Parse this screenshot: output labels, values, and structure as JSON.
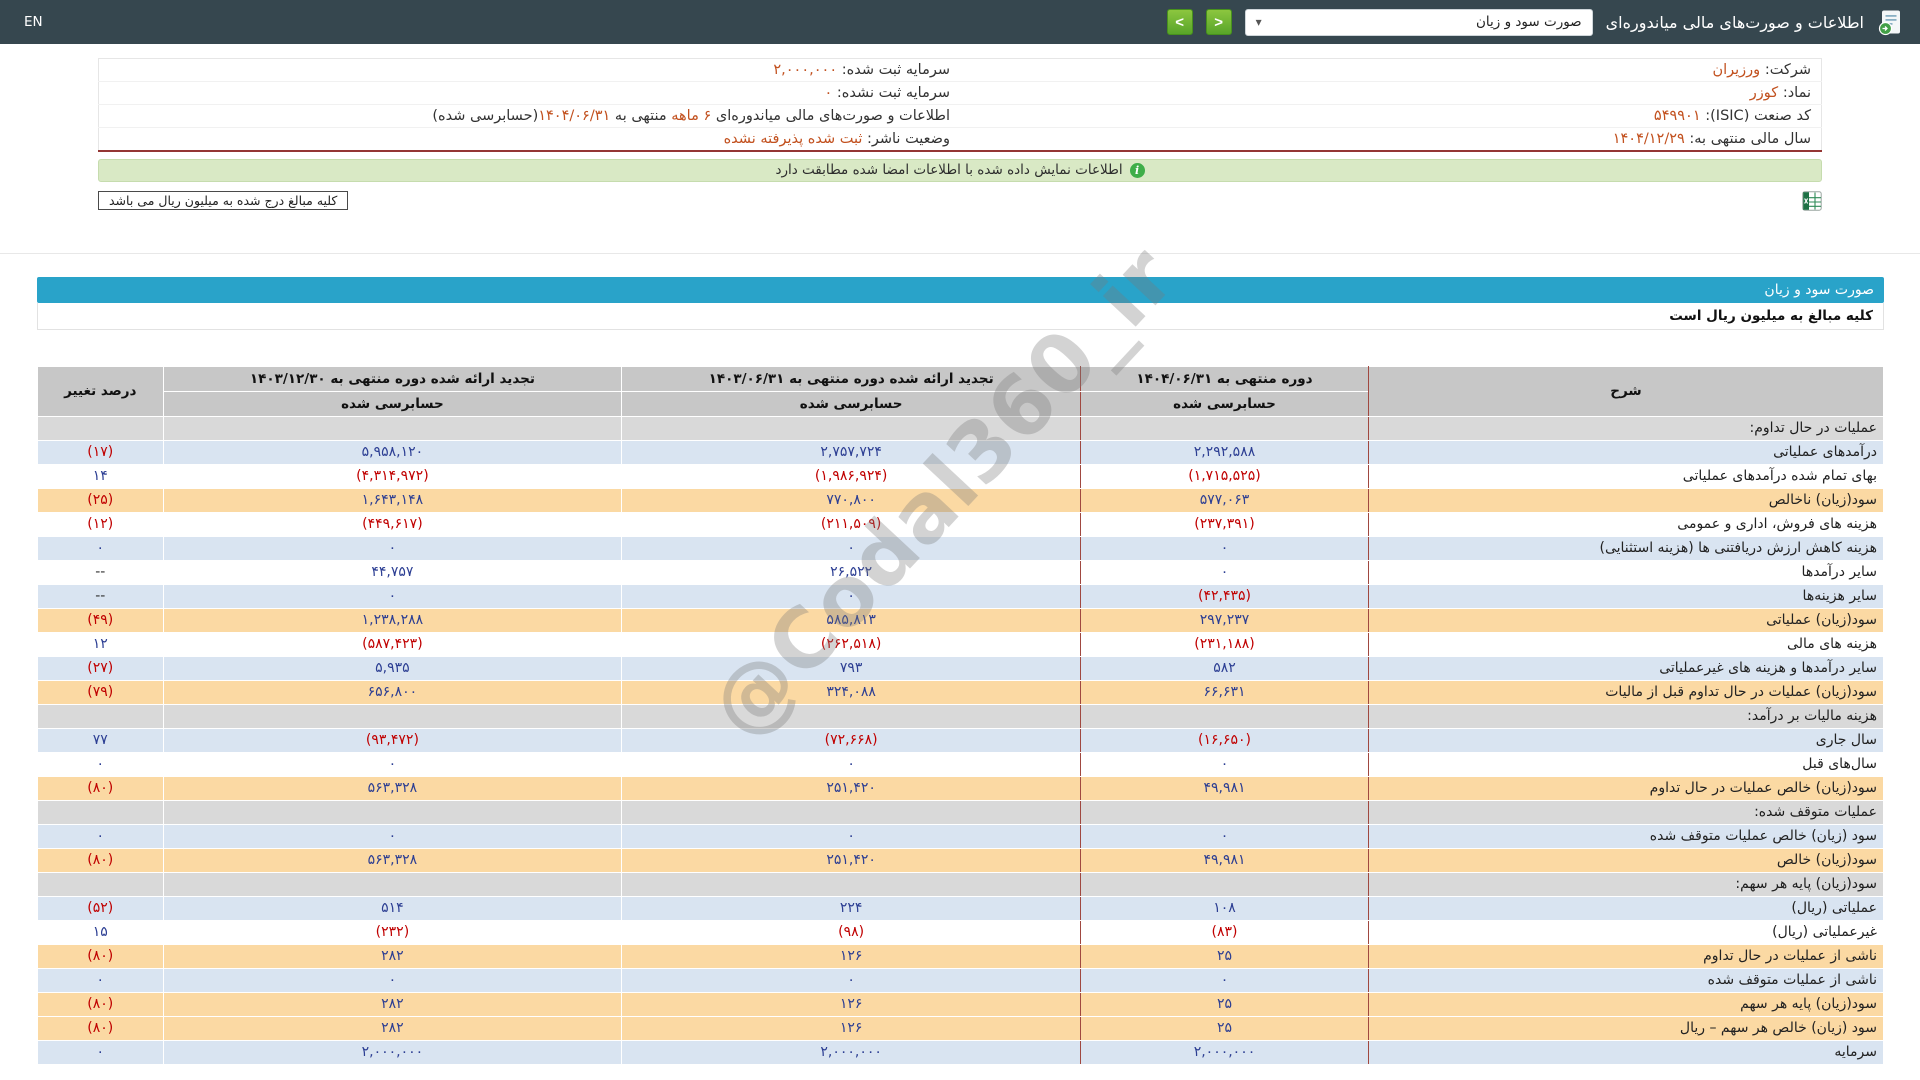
{
  "topbar": {
    "title": "اطلاعات و صورت‌های مالی میاندوره‌ای",
    "select_value": "صورت سود و زیان",
    "select_caret": "▾",
    "prev_glyph": "<",
    "next_glyph": ">",
    "lang": "EN"
  },
  "company": {
    "company_label": "شرکت:",
    "company_value": "ورزیران",
    "symbol_label": "نماد:",
    "symbol_value": "کوزر",
    "isic_label": "کد صنعت (ISIC):",
    "isic_value": "۵۴۹۹۰۱",
    "fiscal_year_label": "سال مالی منتهی به:",
    "fiscal_year_value": "۱۴۰۴/۱۲/۲۹",
    "capital_registered_label": "سرمایه ثبت شده:",
    "capital_registered_value": "۲,۰۰۰,۰۰۰",
    "capital_unregistered_label": "سرمایه ثبت نشده:",
    "capital_unregistered_value": "۰",
    "period_prefix": "اطلاعات و صورت‌های مالی میاندوره‌ای",
    "period_months": "۶ ماهه",
    "period_middle": "منتهی به",
    "period_date": "۱۴۰۴/۰۶/۳۱",
    "period_suffix": "(حسابرسی شده)",
    "status_label": "وضعیت ناشر:",
    "status_value": "ثبت شده پذیرفته نشده"
  },
  "notice": {
    "text": "اطلاعات نمایش داده شده با اطلاعات امضا شده مطابقت دارد",
    "icon": "i"
  },
  "unit_note": "کلیه مبالغ درج شده به میلیون ریال می باشد",
  "statement": {
    "title": "صورت سود و زیان",
    "unit_line": "کلیه مبالغ به میلیون ریال است",
    "watermark": "@Codal360_ir",
    "header": {
      "desc": "شرح",
      "col1_title": "دوره منتهی به ۱۴۰۴/۰۶/۳۱",
      "col2_title": "تجدید ارائه شده دوره منتهی به ۱۴۰۳/۰۶/۳۱",
      "col3_title": "تجدید ارائه شده دوره منتهی به ۱۴۰۳/۱۲/۳۰",
      "audited": "حسابرسی شده",
      "pct": "درصد تغییر"
    },
    "rows": [
      {
        "label": "عملیات در حال تداوم:",
        "style": "section"
      },
      {
        "label": "درآمدهای عملیاتی",
        "v1": "۲,۲۹۲,۵۸۸",
        "v2": "۲,۷۵۷,۷۲۴",
        "v3": "۵,۹۵۸,۱۲۰",
        "pct": "(۱۷)",
        "style": "blue"
      },
      {
        "label": "بهای تمام شده درآمدهای عملیاتی",
        "v1": "(۱,۷۱۵,۵۲۵)",
        "v2": "(۱,۹۸۶,۹۲۴)",
        "v3": "(۴,۳۱۴,۹۷۲)",
        "pct": "۱۴",
        "style": "white"
      },
      {
        "label": "سود(زیان) ناخالص",
        "v1": "۵۷۷,۰۶۳",
        "v2": "۷۷۰,۸۰۰",
        "v3": "۱,۶۴۳,۱۴۸",
        "pct": "(۲۵)",
        "style": "yellow"
      },
      {
        "label": "هزینه های فروش، اداری و عمومی",
        "v1": "(۲۳۷,۳۹۱)",
        "v2": "(۲۱۱,۵۰۹)",
        "v3": "(۴۴۹,۶۱۷)",
        "pct": "(۱۲)",
        "style": "white"
      },
      {
        "label": "هزینه کاهش ارزش دریافتنی ها (هزینه استثنایی)",
        "v1": "۰",
        "v2": "۰",
        "v3": "۰",
        "pct": "۰",
        "style": "blue"
      },
      {
        "label": "سایر درآمدها",
        "v1": "۰",
        "v2": "۲۶,۵۲۲",
        "v3": "۴۴,۷۵۷",
        "pct": "--",
        "style": "white"
      },
      {
        "label": "سایر هزینه‌ها",
        "v1": "(۴۲,۴۳۵)",
        "v2": "۰",
        "v3": "۰",
        "pct": "--",
        "style": "blue"
      },
      {
        "label": "سود(زیان) عملیاتی",
        "v1": "۲۹۷,۲۳۷",
        "v2": "۵۸۵,۸۱۳",
        "v3": "۱,۲۳۸,۲۸۸",
        "pct": "(۴۹)",
        "style": "yellow"
      },
      {
        "label": "هزینه های مالی",
        "v1": "(۲۳۱,۱۸۸)",
        "v2": "(۲۶۲,۵۱۸)",
        "v3": "(۵۸۷,۴۲۳)",
        "pct": "۱۲",
        "style": "white"
      },
      {
        "label": "سایر درآمدها و هزینه های غیرعملیاتی",
        "v1": "۵۸۲",
        "v2": "۷۹۳",
        "v3": "۵,۹۳۵",
        "pct": "(۲۷)",
        "style": "blue"
      },
      {
        "label": "سود(زیان) عملیات در حال تداوم قبل از مالیات",
        "v1": "۶۶,۶۳۱",
        "v2": "۳۲۴,۰۸۸",
        "v3": "۶۵۶,۸۰۰",
        "pct": "(۷۹)",
        "style": "yellow"
      },
      {
        "label": "هزینه مالیات بر درآمد:",
        "style": "section"
      },
      {
        "label": "سال جاری",
        "v1": "(۱۶,۶۵۰)",
        "v2": "(۷۲,۶۶۸)",
        "v3": "(۹۳,۴۷۲)",
        "pct": "۷۷",
        "style": "blue"
      },
      {
        "label": "سال‌های قبل",
        "v1": "۰",
        "v2": "۰",
        "v3": "۰",
        "pct": "۰",
        "style": "white"
      },
      {
        "label": "سود(زیان) خالص عملیات در حال تداوم",
        "v1": "۴۹,۹۸۱",
        "v2": "۲۵۱,۴۲۰",
        "v3": "۵۶۳,۳۲۸",
        "pct": "(۸۰)",
        "style": "yellow"
      },
      {
        "label": "عملیات متوقف شده:",
        "style": "section"
      },
      {
        "label": "سود (زیان) خالص عملیات متوقف شده",
        "v1": "۰",
        "v2": "۰",
        "v3": "۰",
        "pct": "۰",
        "style": "blue"
      },
      {
        "label": "سود(زیان) خالص",
        "v1": "۴۹,۹۸۱",
        "v2": "۲۵۱,۴۲۰",
        "v3": "۵۶۳,۳۲۸",
        "pct": "(۸۰)",
        "style": "yellow"
      },
      {
        "label": "سود(زیان) پایه هر سهم:",
        "style": "section"
      },
      {
        "label": "عملیاتی (ریال)",
        "v1": "۱۰۸",
        "v2": "۲۲۴",
        "v3": "۵۱۴",
        "pct": "(۵۲)",
        "style": "blue"
      },
      {
        "label": "غیرعملیاتی (ریال)",
        "v1": "(۸۳)",
        "v2": "(۹۸)",
        "v3": "(۲۳۲)",
        "pct": "۱۵",
        "style": "white"
      },
      {
        "label": "ناشی از عملیات در حال تداوم",
        "v1": "۲۵",
        "v2": "۱۲۶",
        "v3": "۲۸۲",
        "pct": "(۸۰)",
        "style": "yellow"
      },
      {
        "label": "ناشی از عملیات متوقف شده",
        "v1": "۰",
        "v2": "۰",
        "v3": "۰",
        "pct": "۰",
        "style": "blue"
      },
      {
        "label": "سود(زیان) پایه هر سهم",
        "v1": "۲۵",
        "v2": "۱۲۶",
        "v3": "۲۸۲",
        "pct": "(۸۰)",
        "style": "yellow"
      },
      {
        "label": "سود (زیان) خالص هر سهم – ریال",
        "v1": "۲۵",
        "v2": "۱۲۶",
        "v3": "۲۸۲",
        "pct": "(۸۰)",
        "style": "yellow"
      },
      {
        "label": "سرمایه",
        "v1": "۲,۰۰۰,۰۰۰",
        "v2": "۲,۰۰۰,۰۰۰",
        "v3": "۲,۰۰۰,۰۰۰",
        "pct": "۰",
        "style": "blue"
      }
    ]
  }
}
